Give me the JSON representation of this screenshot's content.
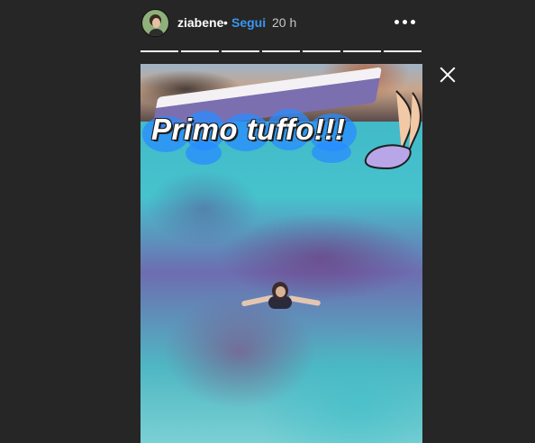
{
  "header": {
    "username": "ziabene",
    "separator": "•",
    "follow_label": "Segui",
    "time_ago": "20 h"
  },
  "progress": {
    "segments": 7
  },
  "story": {
    "caption": "Primo tuffo!!!"
  },
  "colors": {
    "background": "#262626",
    "follow": "#3897f0",
    "bubble": "#2a8cff",
    "sticker": "#b9a6e8"
  },
  "icons": {
    "more": "more-options-icon",
    "close": "close-icon"
  }
}
